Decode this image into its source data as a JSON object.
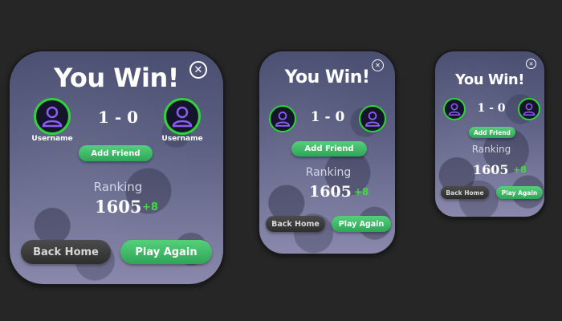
{
  "dialogs": [
    {
      "size": "large",
      "title": "You Win!",
      "close_icon": "close-circle-icon",
      "player_left": {
        "username": "Username",
        "icon": "user-avatar-icon"
      },
      "player_right": {
        "username": "Username",
        "icon": "user-avatar-icon"
      },
      "score": "1 - 0",
      "add_friend_label": "Add Friend",
      "ranking_label": "Ranking",
      "ranking_value": "1605",
      "ranking_delta": "+8",
      "back_home_label": "Back Home",
      "play_again_label": "Play Again"
    },
    {
      "size": "medium",
      "title": "You Win!",
      "close_icon": "close-circle-icon",
      "player_left": {
        "icon": "user-avatar-icon"
      },
      "player_right": {
        "icon": "user-avatar-icon"
      },
      "score": "1 - 0",
      "add_friend_label": "Add Friend",
      "ranking_label": "Ranking",
      "ranking_value": "1605",
      "ranking_delta": "+8",
      "back_home_label": "Back Home",
      "play_again_label": "Play Again"
    },
    {
      "size": "small",
      "title": "You Win!",
      "close_icon": "close-circle-icon",
      "player_left": {
        "icon": "user-avatar-icon"
      },
      "player_right": {
        "icon": "user-avatar-icon"
      },
      "score": "1 - 0",
      "add_friend_label": "Add Friend",
      "ranking_label": "Ranking",
      "ranking_value": "1605",
      "ranking_delta": "+8",
      "back_home_label": "Back Home",
      "play_again_label": "Play Again"
    }
  ],
  "colors": {
    "background": "#262626",
    "avatar_ring": "#2fd23a",
    "avatar_glyph": "#8b5cf6",
    "button_green": "#3dba65",
    "button_dark": "#3a3a3a",
    "delta_green": "#3fdc3f"
  }
}
